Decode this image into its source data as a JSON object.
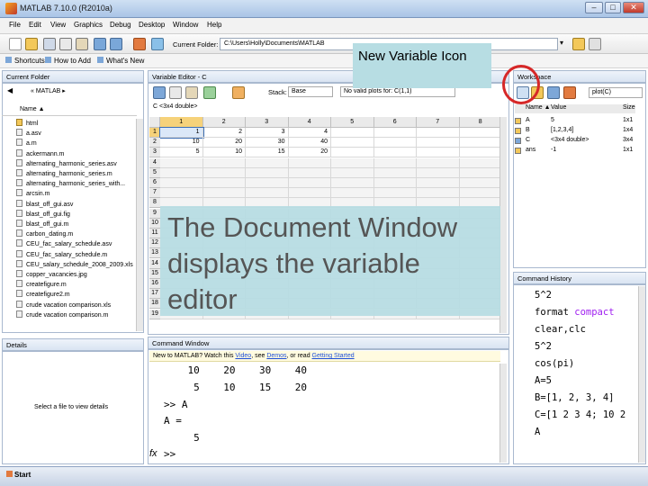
{
  "window": {
    "title": "MATLAB 7.10.0 (R2010a)"
  },
  "menu": [
    "File",
    "Edit",
    "View",
    "Graphics",
    "Debug",
    "Desktop",
    "Window",
    "Help"
  ],
  "toolbar": {
    "current_folder_label": "Current Folder:",
    "current_folder_path": "C:\\Users\\Holly\\Documents\\MATLAB"
  },
  "shortcuts": {
    "label": "Shortcuts",
    "how_to_add": "How to Add",
    "whats_new": "What's New"
  },
  "current_folder": {
    "title": "Current Folder",
    "path": "« MATLAB ▸",
    "name_col": "Name ▲",
    "files": [
      "html",
      "a.asv",
      "a.m",
      "ackermann.m",
      "alternating_harmonic_series.asv",
      "alternating_harmonic_series.m",
      "alternating_harmonic_series_with...",
      "arcsin.m",
      "blast_off_gui.asv",
      "blast_off_gui.fig",
      "blast_off_gui.m",
      "carbon_dating.m",
      "CEU_fac_salary_schedule.asv",
      "CEU_fac_salary_schedule.m",
      "CEU_salary_schedule_2008_2009.xls",
      "copper_vacancies.jpg",
      "createfigure.m",
      "createfigure2.m",
      "crude vacation comparison.xls",
      "crude vacation comparison.m"
    ],
    "details_title": "Details",
    "details_text": "Select a file to view details"
  },
  "variable_editor": {
    "title": "Variable Editor - C",
    "stack_label": "Stack:",
    "stack_value": "Base",
    "plot_select": "No valid plots for: C(1,1)",
    "var_tab": "C <3x4 double>",
    "col_headers": [
      "1",
      "2",
      "3",
      "4",
      "5",
      "6",
      "7",
      "8"
    ],
    "row_headers": [
      "1",
      "2",
      "3",
      "4",
      "5",
      "6",
      "7",
      "8",
      "9",
      "10",
      "11",
      "12",
      "13",
      "14",
      "15",
      "16",
      "17",
      "18",
      "19"
    ],
    "rows": [
      [
        "1",
        "2",
        "3",
        "4"
      ],
      [
        "10",
        "20",
        "30",
        "40"
      ],
      [
        "5",
        "10",
        "15",
        "20"
      ]
    ]
  },
  "command_window": {
    "title": "Command Window",
    "banner_prefix": "New to MATLAB? Watch this ",
    "banner_video": "Video",
    "banner_mid": ", see ",
    "banner_demos": "Demos",
    "banner_or": ", or read ",
    "banner_gs": "Getting Started",
    "lines": [
      "    10    20    30    40",
      "     5    10    15    20",
      ">> A",
      "A =",
      "     5",
      ">>"
    ],
    "fx": "fx"
  },
  "workspace": {
    "title": "Workspace",
    "plot_select": "plot(C)",
    "headers": {
      "name": "Name ▲",
      "value": "Value",
      "size": "Size"
    },
    "vars": [
      {
        "name": "A",
        "value": "5",
        "size": "1x1"
      },
      {
        "name": "B",
        "value": "[1,2,3,4]",
        "size": "1x4"
      },
      {
        "name": "C",
        "value": "<3x4 double>",
        "size": "3x4"
      },
      {
        "name": "ans",
        "value": "-1",
        "size": "1x1"
      }
    ]
  },
  "command_history": {
    "title": "Command History",
    "lines": [
      "5^2",
      "format compact",
      "clear,clc",
      "5^2",
      "cos(pi)",
      "A=5",
      "B=[1, 2, 3, 4]",
      "C=[1 2 3 4; 10 2",
      "A"
    ]
  },
  "callouts": {
    "new_variable": "New Variable Icon",
    "document_window": "The Document Window displays the variable editor"
  },
  "taskbar": {
    "start": "Start"
  },
  "colors": {
    "callout": "#b7dde3",
    "highlight_circle": "#d62828",
    "keyword_purple": "#a020f0"
  }
}
